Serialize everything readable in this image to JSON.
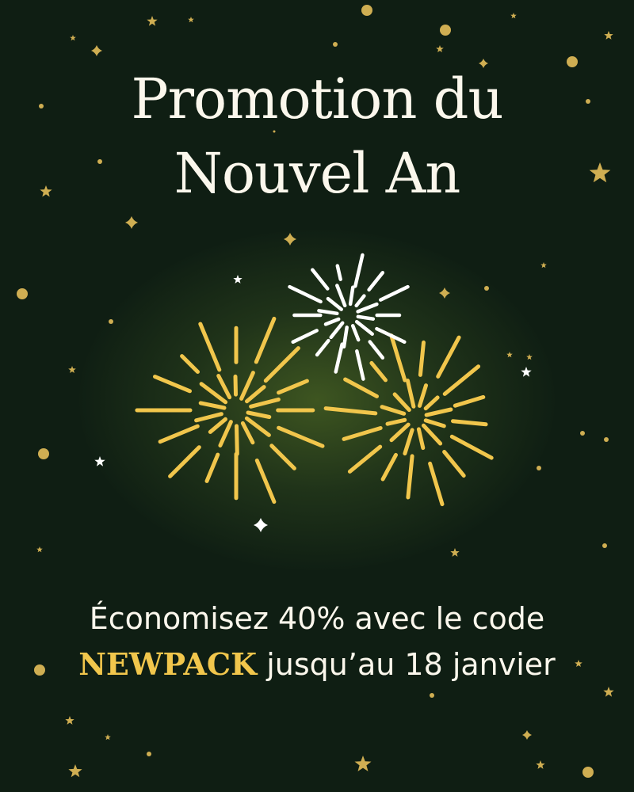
{
  "title": {
    "line1": "Promotion du",
    "line2": "Nouvel An"
  },
  "offer": {
    "before_code": "Économisez 40% avec le code ",
    "code": "NEWPACK",
    "after_code": " jusqu’au 18 janvier"
  },
  "colors": {
    "background": "#0f1e13",
    "gold": "#f1c64c",
    "star_gold": "#cfae52",
    "text": "#fbf7ec"
  },
  "icons": [
    "firework-icon",
    "star-icon",
    "dot-icon",
    "sparkle-icon"
  ]
}
